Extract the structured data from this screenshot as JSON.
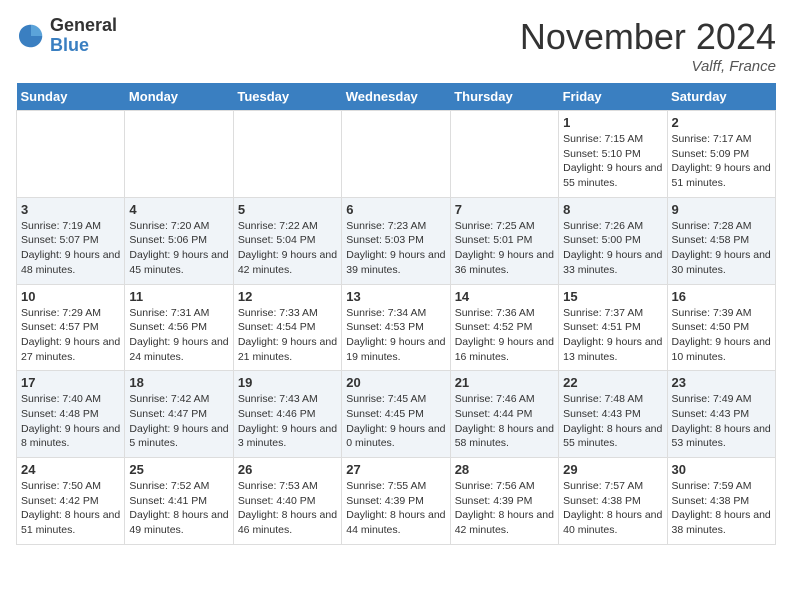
{
  "logo": {
    "general": "General",
    "blue": "Blue"
  },
  "header": {
    "month": "November 2024",
    "location": "Valff, France"
  },
  "weekdays": [
    "Sunday",
    "Monday",
    "Tuesday",
    "Wednesday",
    "Thursday",
    "Friday",
    "Saturday"
  ],
  "weeks": [
    [
      {
        "day": "",
        "info": ""
      },
      {
        "day": "",
        "info": ""
      },
      {
        "day": "",
        "info": ""
      },
      {
        "day": "",
        "info": ""
      },
      {
        "day": "",
        "info": ""
      },
      {
        "day": "1",
        "info": "Sunrise: 7:15 AM\nSunset: 5:10 PM\nDaylight: 9 hours and 55 minutes."
      },
      {
        "day": "2",
        "info": "Sunrise: 7:17 AM\nSunset: 5:09 PM\nDaylight: 9 hours and 51 minutes."
      }
    ],
    [
      {
        "day": "3",
        "info": "Sunrise: 7:19 AM\nSunset: 5:07 PM\nDaylight: 9 hours and 48 minutes."
      },
      {
        "day": "4",
        "info": "Sunrise: 7:20 AM\nSunset: 5:06 PM\nDaylight: 9 hours and 45 minutes."
      },
      {
        "day": "5",
        "info": "Sunrise: 7:22 AM\nSunset: 5:04 PM\nDaylight: 9 hours and 42 minutes."
      },
      {
        "day": "6",
        "info": "Sunrise: 7:23 AM\nSunset: 5:03 PM\nDaylight: 9 hours and 39 minutes."
      },
      {
        "day": "7",
        "info": "Sunrise: 7:25 AM\nSunset: 5:01 PM\nDaylight: 9 hours and 36 minutes."
      },
      {
        "day": "8",
        "info": "Sunrise: 7:26 AM\nSunset: 5:00 PM\nDaylight: 9 hours and 33 minutes."
      },
      {
        "day": "9",
        "info": "Sunrise: 7:28 AM\nSunset: 4:58 PM\nDaylight: 9 hours and 30 minutes."
      }
    ],
    [
      {
        "day": "10",
        "info": "Sunrise: 7:29 AM\nSunset: 4:57 PM\nDaylight: 9 hours and 27 minutes."
      },
      {
        "day": "11",
        "info": "Sunrise: 7:31 AM\nSunset: 4:56 PM\nDaylight: 9 hours and 24 minutes."
      },
      {
        "day": "12",
        "info": "Sunrise: 7:33 AM\nSunset: 4:54 PM\nDaylight: 9 hours and 21 minutes."
      },
      {
        "day": "13",
        "info": "Sunrise: 7:34 AM\nSunset: 4:53 PM\nDaylight: 9 hours and 19 minutes."
      },
      {
        "day": "14",
        "info": "Sunrise: 7:36 AM\nSunset: 4:52 PM\nDaylight: 9 hours and 16 minutes."
      },
      {
        "day": "15",
        "info": "Sunrise: 7:37 AM\nSunset: 4:51 PM\nDaylight: 9 hours and 13 minutes."
      },
      {
        "day": "16",
        "info": "Sunrise: 7:39 AM\nSunset: 4:50 PM\nDaylight: 9 hours and 10 minutes."
      }
    ],
    [
      {
        "day": "17",
        "info": "Sunrise: 7:40 AM\nSunset: 4:48 PM\nDaylight: 9 hours and 8 minutes."
      },
      {
        "day": "18",
        "info": "Sunrise: 7:42 AM\nSunset: 4:47 PM\nDaylight: 9 hours and 5 minutes."
      },
      {
        "day": "19",
        "info": "Sunrise: 7:43 AM\nSunset: 4:46 PM\nDaylight: 9 hours and 3 minutes."
      },
      {
        "day": "20",
        "info": "Sunrise: 7:45 AM\nSunset: 4:45 PM\nDaylight: 9 hours and 0 minutes."
      },
      {
        "day": "21",
        "info": "Sunrise: 7:46 AM\nSunset: 4:44 PM\nDaylight: 8 hours and 58 minutes."
      },
      {
        "day": "22",
        "info": "Sunrise: 7:48 AM\nSunset: 4:43 PM\nDaylight: 8 hours and 55 minutes."
      },
      {
        "day": "23",
        "info": "Sunrise: 7:49 AM\nSunset: 4:43 PM\nDaylight: 8 hours and 53 minutes."
      }
    ],
    [
      {
        "day": "24",
        "info": "Sunrise: 7:50 AM\nSunset: 4:42 PM\nDaylight: 8 hours and 51 minutes."
      },
      {
        "day": "25",
        "info": "Sunrise: 7:52 AM\nSunset: 4:41 PM\nDaylight: 8 hours and 49 minutes."
      },
      {
        "day": "26",
        "info": "Sunrise: 7:53 AM\nSunset: 4:40 PM\nDaylight: 8 hours and 46 minutes."
      },
      {
        "day": "27",
        "info": "Sunrise: 7:55 AM\nSunset: 4:39 PM\nDaylight: 8 hours and 44 minutes."
      },
      {
        "day": "28",
        "info": "Sunrise: 7:56 AM\nSunset: 4:39 PM\nDaylight: 8 hours and 42 minutes."
      },
      {
        "day": "29",
        "info": "Sunrise: 7:57 AM\nSunset: 4:38 PM\nDaylight: 8 hours and 40 minutes."
      },
      {
        "day": "30",
        "info": "Sunrise: 7:59 AM\nSunset: 4:38 PM\nDaylight: 8 hours and 38 minutes."
      }
    ]
  ]
}
